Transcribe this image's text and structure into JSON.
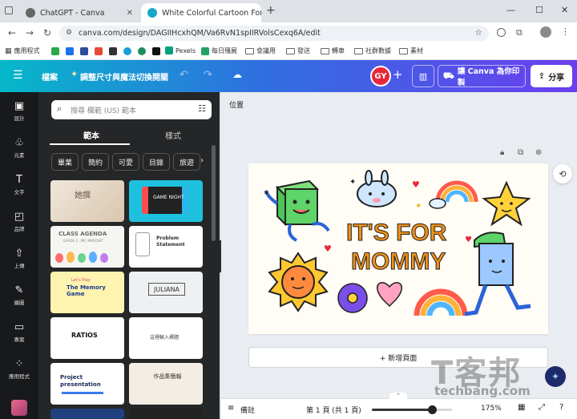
{
  "browser": {
    "tabs": [
      {
        "title": "ChatGPT - Canva"
      },
      {
        "title": "White Colorful Cartoon For M"
      }
    ],
    "new_tab": "+",
    "window_controls": {
      "minimize": "—",
      "maximize": "☐",
      "close": "✕"
    },
    "url": "canva.com/design/DAGIIHcxhQM/Va6RvN1spIIRVolsCexq6A/edit",
    "bookmarks": [
      {
        "label": "應用程式",
        "type": "apps"
      },
      {
        "label": "Pexels",
        "type": "site"
      },
      {
        "label": "每日殭屍",
        "type": "site"
      },
      {
        "label": "會議用",
        "type": "folder"
      },
      {
        "label": "發送",
        "type": "folder"
      },
      {
        "label": "轉車",
        "type": "folder"
      },
      {
        "label": "社群數據",
        "type": "folder"
      },
      {
        "label": "素材",
        "type": "folder"
      }
    ]
  },
  "header": {
    "file_label": "檔案",
    "resize_label": "調整尺寸與魔法切換開關",
    "avatar_initials": "GY",
    "print_label": "讓 Canva 為你印製",
    "share_label": "分享"
  },
  "rail": [
    {
      "label": "設計",
      "icon": "design-icon"
    },
    {
      "label": "元素",
      "icon": "elements-icon"
    },
    {
      "label": "文字",
      "icon": "text-icon"
    },
    {
      "label": "品牌",
      "icon": "brand-icon"
    },
    {
      "label": "上傳",
      "icon": "upload-icon"
    },
    {
      "label": "繪圖",
      "icon": "draw-icon"
    },
    {
      "label": "專案",
      "icon": "projects-icon"
    },
    {
      "label": "應用程式",
      "icon": "apps-icon"
    }
  ],
  "panel": {
    "search_placeholder": "搜尋 欄範 (US) 範本",
    "tabs": [
      {
        "label": "範本"
      },
      {
        "label": "樣式"
      }
    ],
    "chips": [
      "畢業",
      "簡約",
      "可愛",
      "目錄",
      "旅遊"
    ],
    "thumbs": [
      {
        "title": "她撰",
        "sub": ""
      },
      {
        "title": "GAME NIGHT",
        "sub": ""
      },
      {
        "title": "CLASS AGENDA",
        "sub": "GRADE 2 · MR. MARCHET"
      },
      {
        "title": "Problem Statement",
        "sub": ""
      },
      {
        "title": "The Memory Game",
        "sub": "Let's Play"
      },
      {
        "title": "JULIANA",
        "sub": ""
      },
      {
        "title": "RATIOS",
        "sub": ""
      },
      {
        "title": "這裡輸入標題",
        "sub": ""
      },
      {
        "title": "Project presentation",
        "sub": ""
      },
      {
        "title": "作品集簡報",
        "sub": ""
      }
    ]
  },
  "workspace": {
    "position_label": "位置",
    "design_text_line1": "IT'S FOR",
    "design_text_line2": "MOMMY",
    "add_page_label": "+ 新增頁面"
  },
  "bottom": {
    "notes_label": "備註",
    "page_indicator": "第 1 頁 (共 1 頁)",
    "zoom": "175%",
    "zoom_fraction": 0.75
  },
  "watermark": {
    "big": "T客邦",
    "url": "techbang.com"
  },
  "colors": {
    "accent": "#8b3dff",
    "design_orange": "#f0901a"
  }
}
